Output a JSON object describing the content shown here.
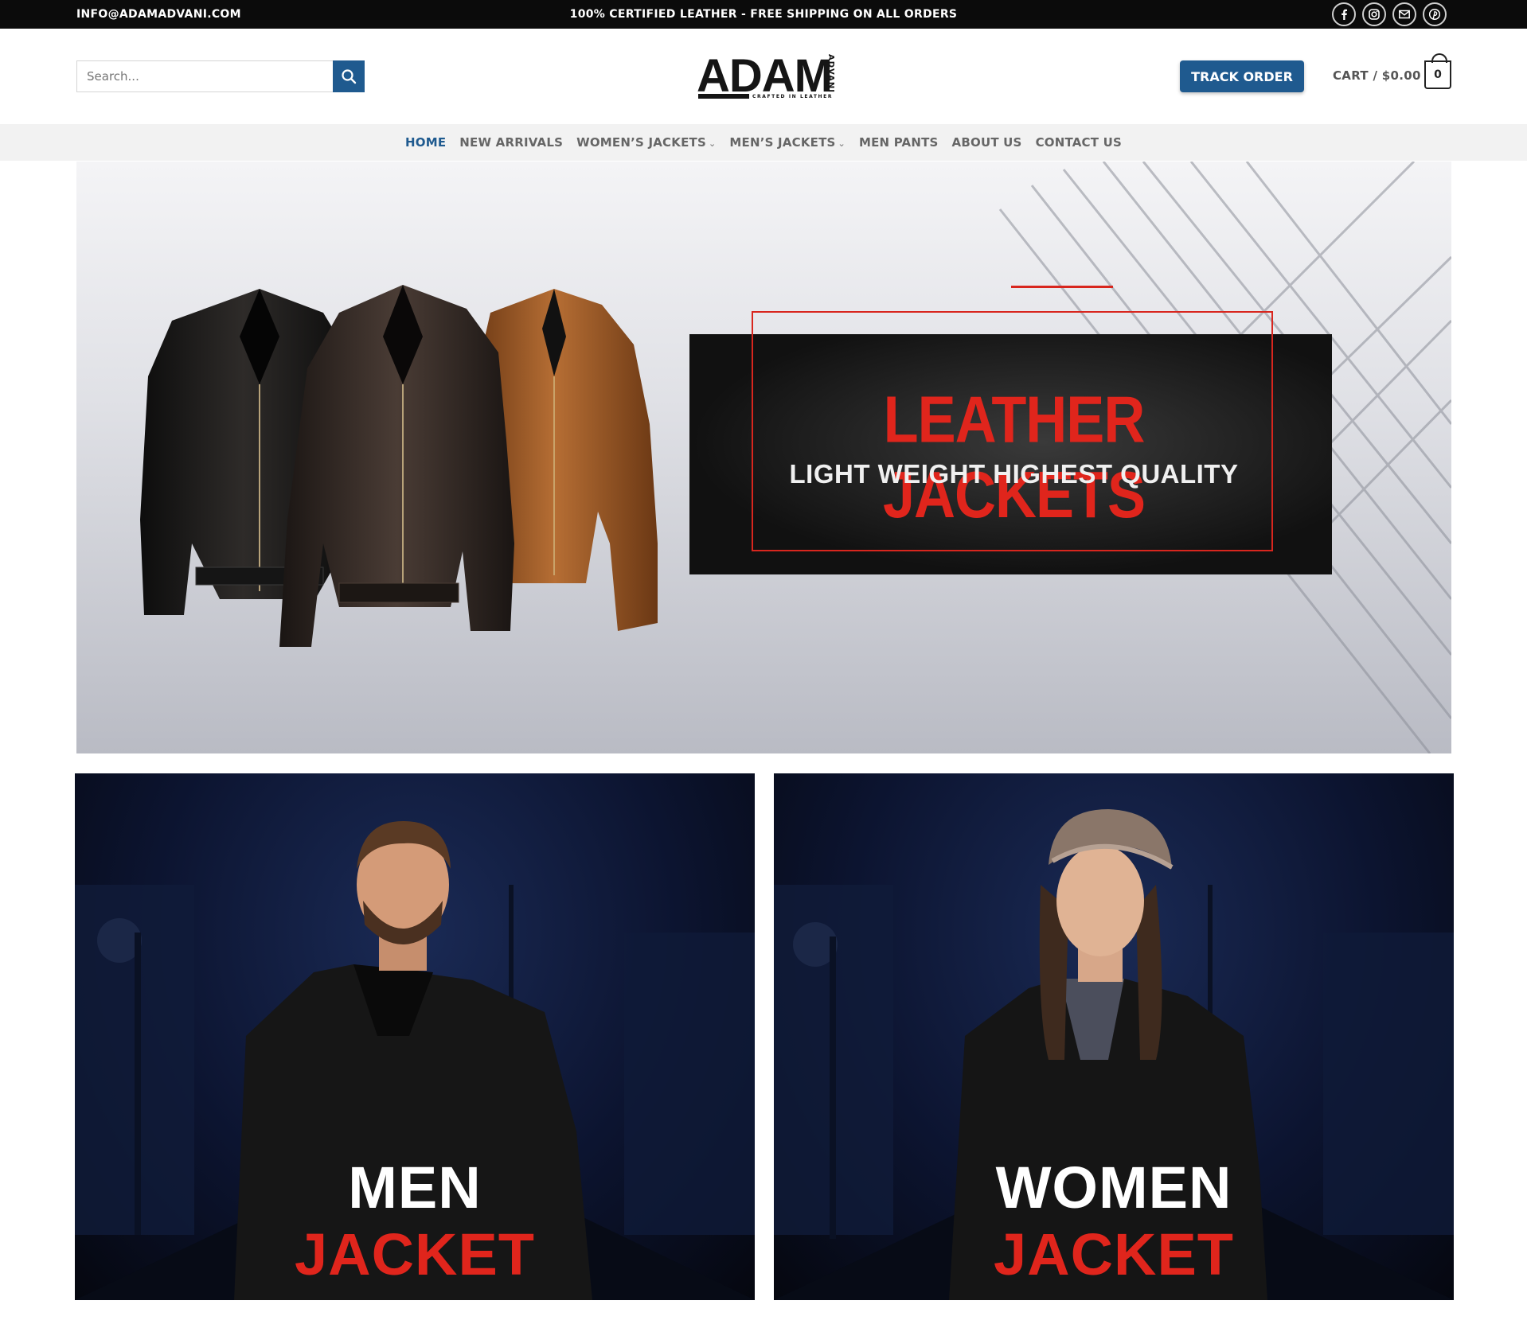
{
  "topbar": {
    "email": "INFO@ADAMADVANI.COM",
    "promo": "100% CERTIFIED LEATHER - FREE SHIPPING ON ALL ORDERS",
    "social_icons": [
      "facebook-icon",
      "instagram-icon",
      "email-icon",
      "pinterest-icon"
    ]
  },
  "header": {
    "search_placeholder": "Search...",
    "logo_text": "ADAM",
    "logo_side_text": "ADVANI",
    "logo_tagline": "CRAFTED IN LEATHER",
    "track_order_label": "TRACK ORDER",
    "cart_label": "CART / $0.00",
    "cart_count": "0"
  },
  "nav": {
    "items": [
      {
        "label": "HOME",
        "active": true
      },
      {
        "label": "NEW ARRIVALS"
      },
      {
        "label": "WOMEN’S JACKETS",
        "dropdown": true
      },
      {
        "label": "MEN’S JACKETS",
        "dropdown": true
      },
      {
        "label": "MEN PANTS"
      },
      {
        "label": "ABOUT US"
      },
      {
        "label": "CONTACT US"
      }
    ]
  },
  "hero": {
    "title": "LEATHER JACKETS",
    "subtitle": "LIGHT WEIGHT  HIGHEST QUALITY"
  },
  "categories": [
    {
      "line1": "MEN",
      "line2": "JACKET"
    },
    {
      "line1": "WOMEN",
      "line2": "JACKET"
    }
  ],
  "colors": {
    "primary_blue": "#1f5a8f",
    "accent_red": "#e0251c",
    "topbar_black": "#0b0b0b"
  }
}
